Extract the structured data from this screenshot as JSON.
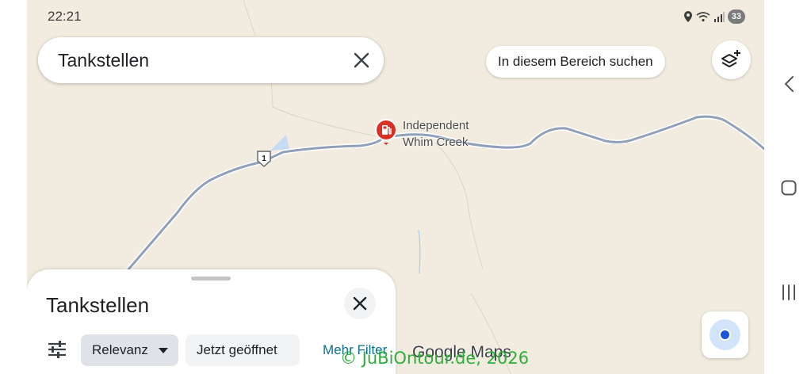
{
  "status_bar": {
    "time": "22:21",
    "battery": "33",
    "icons": [
      "location-icon",
      "wifi-icon",
      "signal-icon"
    ]
  },
  "search": {
    "query": "Tankstellen",
    "clear_icon": "close-icon"
  },
  "map": {
    "search_area_button": "In diesem Bereich suchen",
    "layers_icon": "layers-add-icon",
    "poi": {
      "name_line1": "Independent",
      "name_line2": "Whim Creek",
      "icon": "gas-station-icon",
      "color": "#d93025"
    },
    "route_shield": "1",
    "road_color": "#8fa0b8",
    "background_color": "#f1ecdf",
    "logo": "Google Maps"
  },
  "sheet": {
    "title": "Tankstellen",
    "close_icon": "close-icon",
    "filter_icon": "tune-icon",
    "chips": {
      "sort": "Relevanz",
      "open_now": "Jetzt geöffnet"
    },
    "more_filters": "Mehr Filter"
  },
  "location_button": {
    "icon": "my-location-icon",
    "accent": "#1a56db"
  },
  "watermark": "© JuBiOntour.de, 2026",
  "system_nav": {
    "back": "back-icon",
    "home": "home-icon",
    "recents": "recents-icon"
  }
}
